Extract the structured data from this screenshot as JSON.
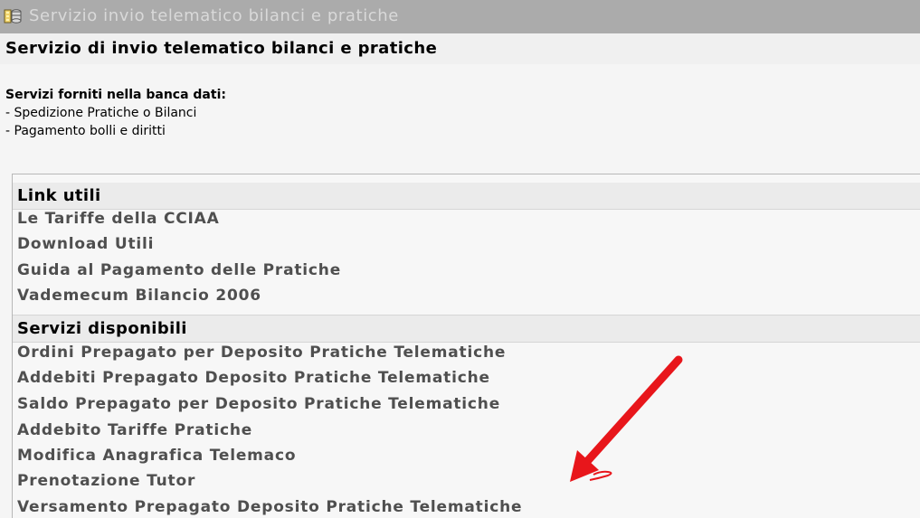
{
  "header": {
    "title": "Servizio invio telematico bilanci e pratiche",
    "icon": "folder-database-icon",
    "background_color": "#ababab"
  },
  "subtitle": {
    "text": "Servizio di invio telematico bilanci e pratiche"
  },
  "services": {
    "heading": "Servizi forniti nella banca dati:",
    "items": [
      "- Spedizione Pratiche o Bilanci",
      "- Pagamento bolli e diritti"
    ]
  },
  "useful_links": {
    "title": "Link utili",
    "items": [
      "Le Tariffe della CCIAA",
      "Download Utili",
      "Guida al Pagamento delle Pratiche",
      "Vademecum Bilancio 2006"
    ]
  },
  "available_services": {
    "title": "Servizi disponibili",
    "items": [
      "Ordini Prepagato per Deposito Pratiche Telematiche",
      "Addebiti Prepagato Deposito Pratiche Telematiche",
      "Saldo Prepagato per Deposito Pratiche Telematiche",
      "Addebito Tariffe Pratiche",
      "Modifica Anagrafica Telemaco",
      "Prenotazione Tutor",
      "Versamento Prepagato Deposito Pratiche Telematiche"
    ]
  },
  "annotation": {
    "icon": "red-arrow-icon",
    "color": "#e8161b"
  }
}
